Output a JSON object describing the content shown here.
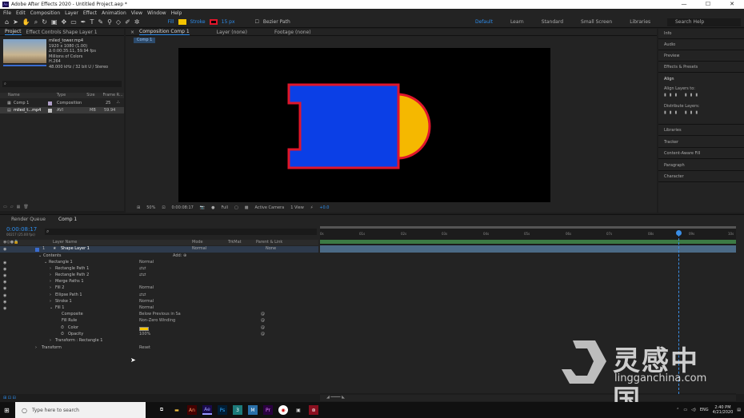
{
  "title_bar": {
    "text": "Adobe After Effects 2020 - Untitled Project.aep *"
  },
  "menu": [
    "File",
    "Edit",
    "Composition",
    "Layer",
    "Effect",
    "Animation",
    "View",
    "Window",
    "Help"
  ],
  "toolbar": {
    "fill_label": "Fill",
    "stroke_label": "Stroke",
    "stroke_px": "15 px",
    "bezier_label": "Bezier Path",
    "fill_color": "#f5c400",
    "stroke_color": "#e0162b"
  },
  "workspaces": [
    "Default",
    "Learn",
    "Standard",
    "Small Screen",
    "Libraries"
  ],
  "search_help": "Search Help",
  "project_panel": {
    "tabs": [
      "Project",
      "Effect Controls Shape Layer 1"
    ],
    "footage_name": "miled_tower.mp4",
    "footage_info": [
      "1920 x 1080 (1.00)",
      "Δ 0:00:35:11, 59.94 fps",
      "Millions of Colors",
      "H.264",
      "48.000 kHz / 32 bit U / Stereo"
    ],
    "columns": [
      "Name",
      "Type",
      "Size",
      "Frame R..."
    ],
    "rows": [
      {
        "name": "Comp 1",
        "type": "Composition",
        "rate": "25"
      },
      {
        "name": "miled_t...mp4",
        "type": "AVI",
        "size": "MB",
        "rate": "59.94"
      }
    ]
  },
  "comp_panel": {
    "tabs": [
      "Composition Comp 1",
      "Layer (none)",
      "Footage (none)"
    ],
    "sub_tab": "Comp 1",
    "controls": {
      "zoom": "50%",
      "timecode": "0:00:08:17",
      "resolution": "Full",
      "camera": "Active Camera",
      "views": "1 View",
      "exposure": "+0.0"
    }
  },
  "right_panel": {
    "items": [
      "Info",
      "Audio",
      "Preview",
      "Effects & Presets",
      "Align",
      "Libraries",
      "Tracker",
      "Content-Aware Fill",
      "Paragraph",
      "Character"
    ],
    "align_to_label": "Align Layers to:",
    "distribute_label": "Distribute Layers:"
  },
  "timeline": {
    "tabs": [
      "Render Queue",
      "Comp 1"
    ],
    "timecode": "0:00:08:17",
    "fps": "00217 (25.00 fps)",
    "col_layer_name": "Layer Name",
    "col_mode": "Mode",
    "col_trkmat": "TrkMat",
    "col_parent": "Parent & Link",
    "add_label": "Add:",
    "ticks": [
      "0s",
      "01s",
      "02s",
      "03s",
      "04s",
      "05s",
      "06s",
      "07s",
      "08s",
      "09s",
      "10s"
    ],
    "layers": [
      {
        "num": "1",
        "name": "Shape Layer 1",
        "mode": "Normal",
        "parent": "None"
      },
      {
        "name": "Contents"
      },
      {
        "name": "Rectangle 1",
        "mode": "Normal"
      },
      {
        "name": "Rectangle Path 1"
      },
      {
        "name": "Rectangle Path 2"
      },
      {
        "name": "Merge Paths 1"
      },
      {
        "name": "Fill 2",
        "mode": "Normal"
      },
      {
        "name": "Ellipse Path 1"
      },
      {
        "name": "Stroke 1",
        "mode": "Normal"
      },
      {
        "name": "Fill 1",
        "mode": "Normal"
      },
      {
        "name": "Composite",
        "mode": "Below Previous in Sa"
      },
      {
        "name": "Fill Rule",
        "mode": "Non-Zero Winding"
      },
      {
        "name": "Color"
      },
      {
        "name": "Opacity",
        "mode": "100%"
      },
      {
        "name": "Transform : Rectangle 1"
      },
      {
        "name": "Transform",
        "mode": "Reset"
      }
    ]
  },
  "shape": {
    "fill_blue": "#0b3fe6",
    "fill_yellow": "#f5b800",
    "stroke": "#e0162b"
  },
  "watermark": {
    "cn": "灵感中国",
    "url": "lingganchina.com"
  },
  "taskbar": {
    "search_placeholder": "Type here to search",
    "lang": "ENG",
    "time": "2:40 PM",
    "date": "4/21/2020"
  }
}
